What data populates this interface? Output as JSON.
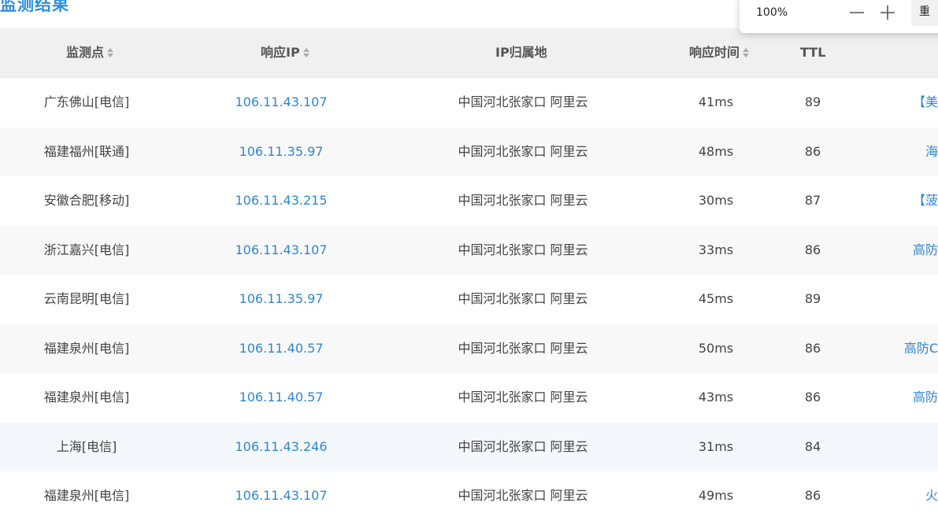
{
  "page_title": "监测结果",
  "zoom": {
    "level": "100%",
    "reset_label": "重"
  },
  "columns": {
    "point": "监测点",
    "ip": "响应IP",
    "location": "IP归属地",
    "time": "响应时间",
    "ttl": "TTL"
  },
  "rows": [
    {
      "point": "广东佛山[电信]",
      "ip": "106.11.43.107",
      "location": "中国河北张家口 阿里云",
      "time": "41ms",
      "ttl": "89",
      "extra": "【美"
    },
    {
      "point": "福建福州[联通]",
      "ip": "106.11.35.97",
      "location": "中国河北张家口 阿里云",
      "time": "48ms",
      "ttl": "86",
      "extra": "海"
    },
    {
      "point": "安徽合肥[移动]",
      "ip": "106.11.43.215",
      "location": "中国河北张家口 阿里云",
      "time": "30ms",
      "ttl": "87",
      "extra": "【菠"
    },
    {
      "point": "浙江嘉兴[电信]",
      "ip": "106.11.43.107",
      "location": "中国河北张家口 阿里云",
      "time": "33ms",
      "ttl": "86",
      "extra": "高防"
    },
    {
      "point": "云南昆明[电信]",
      "ip": "106.11.35.97",
      "location": "中国河北张家口 阿里云",
      "time": "45ms",
      "ttl": "89",
      "extra": ""
    },
    {
      "point": "福建泉州[电信]",
      "ip": "106.11.40.57",
      "location": "中国河北张家口 阿里云",
      "time": "50ms",
      "ttl": "86",
      "extra": "高防C"
    },
    {
      "point": "福建泉州[电信]",
      "ip": "106.11.40.57",
      "location": "中国河北张家口 阿里云",
      "time": "43ms",
      "ttl": "86",
      "extra": "高防"
    },
    {
      "point": "上海[电信]",
      "ip": "106.11.43.246",
      "location": "中国河北张家口 阿里云",
      "time": "31ms",
      "ttl": "84",
      "extra": ""
    },
    {
      "point": "福建泉州[电信]",
      "ip": "106.11.43.107",
      "location": "中国河北张家口 阿里云",
      "time": "49ms",
      "ttl": "86",
      "extra": "火"
    }
  ]
}
